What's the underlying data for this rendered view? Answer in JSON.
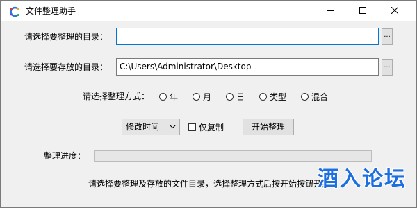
{
  "window": {
    "title": "文件整理助手",
    "icon": "app-colorful-c-icon",
    "controls": {
      "minimize_icon": "minimize-icon",
      "maximize_icon": "maximize-icon",
      "close_icon": "close-icon"
    }
  },
  "source": {
    "label": "请选择要整理的目录：",
    "value": "",
    "browse_label": "..."
  },
  "destination": {
    "label": "请选择要存放的目录：",
    "value": "C:\\Users\\Administrator\\Desktop",
    "browse_label": "..."
  },
  "mode": {
    "label": "请选择整理方式：",
    "options": [
      "年",
      "月",
      "日",
      "类型",
      "混合"
    ],
    "selected": null
  },
  "sort_field": {
    "selected": "修改时间",
    "icon": "chevron-down-icon"
  },
  "copy_only": {
    "label": "仅复制",
    "checked": false
  },
  "start_button": {
    "label": "开始整理"
  },
  "progress": {
    "label": "整理进度：",
    "value": 0
  },
  "status": {
    "text": "请选择要整理及存放的文件目录，选择整理方式后按开始按钮开始"
  },
  "watermark": {
    "text": "酒入论坛"
  },
  "colors": {
    "title_bg": "#ffffff",
    "client_bg": "#f0f0f0",
    "focus_border": "#0078d7",
    "watermark": "#1d6fe0"
  }
}
